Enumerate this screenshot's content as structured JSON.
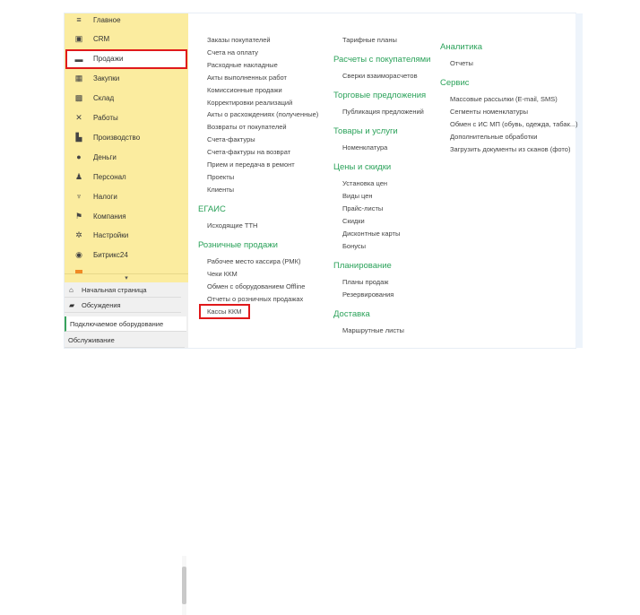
{
  "sidebar": {
    "items": [
      {
        "label": "Главное",
        "icon": "menu-icon",
        "glyph": "≡"
      },
      {
        "label": "CRM",
        "icon": "crm-icon",
        "glyph": "▣"
      },
      {
        "label": "Продажи",
        "icon": "shopping-bag-icon",
        "glyph": "▬",
        "active": true
      },
      {
        "label": "Закупки",
        "icon": "cart-icon",
        "glyph": "▦"
      },
      {
        "label": "Склад",
        "icon": "warehouse-icon",
        "glyph": "▩"
      },
      {
        "label": "Работы",
        "icon": "tools-icon",
        "glyph": "✕"
      },
      {
        "label": "Производство",
        "icon": "factory-icon",
        "glyph": "▙"
      },
      {
        "label": "Деньги",
        "icon": "money-icon",
        "glyph": "●"
      },
      {
        "label": "Персонал",
        "icon": "people-icon",
        "glyph": "♟"
      },
      {
        "label": "Налоги",
        "icon": "emblem-icon",
        "glyph": "♆"
      },
      {
        "label": "Компания",
        "icon": "flag-icon",
        "glyph": "⚑"
      },
      {
        "label": "Настройки",
        "icon": "gear-icon",
        "glyph": "✲"
      },
      {
        "label": "Битрикс24",
        "icon": "bitrix24-icon",
        "glyph": "◉"
      }
    ],
    "more_icon": "chevron-down-icon",
    "bottom": [
      {
        "label": "Начальная страница",
        "icon": "home-icon",
        "glyph": "⌂"
      },
      {
        "label": "Обсуждения",
        "icon": "chat-icon",
        "glyph": "▰"
      },
      {
        "label": "Подключаемое оборудование",
        "selected": true
      },
      {
        "label": "Обслуживание"
      }
    ]
  },
  "columns": [
    [
      {
        "items": [
          "Заказы покупателей",
          "Счета на оплату",
          "Расходные накладные",
          "Акты выполненных работ",
          "Комиссионные продажи",
          "Корректировки реализаций",
          "Акты о расхождениях (полученные)",
          "Возвраты от покупателей",
          "Счета-фактуры",
          "Счета-фактуры на возврат",
          "Прием и передача в ремонт",
          "Проекты",
          "Клиенты"
        ]
      },
      {
        "title": "ЕГАИС",
        "items": [
          "Исходящие ТТН"
        ]
      },
      {
        "title": "Розничные продажи",
        "items": [
          "Рабочее место кассира (РМК)",
          "Чеки ККМ",
          "Обмен с оборудованием Offline",
          "Отчеты о розничных продажах",
          "Кассы ККМ"
        ]
      }
    ],
    [
      {
        "items": [
          "Тарифные планы"
        ]
      },
      {
        "title": "Расчеты с покупателями",
        "items": [
          "Сверки взаиморасчетов"
        ]
      },
      {
        "title": "Торговые предложения",
        "items": [
          "Публикация предложений"
        ]
      },
      {
        "title": "Товары и услуги",
        "items": [
          "Номенклатура"
        ]
      },
      {
        "title": "Цены и скидки",
        "items": [
          "Установка цен",
          "Виды цен",
          "Прайс-листы",
          "Скидки",
          "Дисконтные карты",
          "Бонусы"
        ]
      },
      {
        "title": "Планирование",
        "items": [
          "Планы продаж",
          "Резервирования"
        ]
      },
      {
        "title": "Доставка",
        "items": [
          "Маршрутные листы"
        ]
      }
    ],
    [
      {
        "title": "Аналитика",
        "items": [
          "Отчеты"
        ]
      },
      {
        "title": "Сервис",
        "items": [
          "Массовые рассылки (E-mail, SMS)",
          "Сегменты номенклатуры",
          "Обмен с ИС МП (обувь, одежда, табак...)",
          "Дополнительные обработки",
          "Загрузить документы из сканов (фото)"
        ]
      }
    ]
  ],
  "colors": {
    "sidebar": "#fbec9f",
    "accent": "#2ba25a",
    "highlight": "#e0191b"
  }
}
